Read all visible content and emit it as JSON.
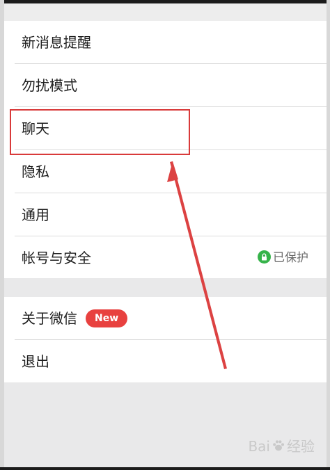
{
  "settings": {
    "items": [
      {
        "label": "新消息提醒"
      },
      {
        "label": "勿扰模式"
      },
      {
        "label": "聊天"
      },
      {
        "label": "隐私"
      },
      {
        "label": "通用"
      },
      {
        "label": "帐号与安全",
        "status": "已保护"
      }
    ],
    "about": {
      "label": "关于微信",
      "badge": "New"
    },
    "logout": {
      "label": "退出"
    }
  },
  "watermark": {
    "text_left": "Bai",
    "text_right": "经验"
  },
  "colors": {
    "highlight": "#d93a3a",
    "badge": "#e8413f",
    "protected": "#36b34a",
    "background": "#e9e9ea"
  },
  "icons": {
    "protected_status": "lock-icon",
    "watermark": "paw-icon"
  }
}
